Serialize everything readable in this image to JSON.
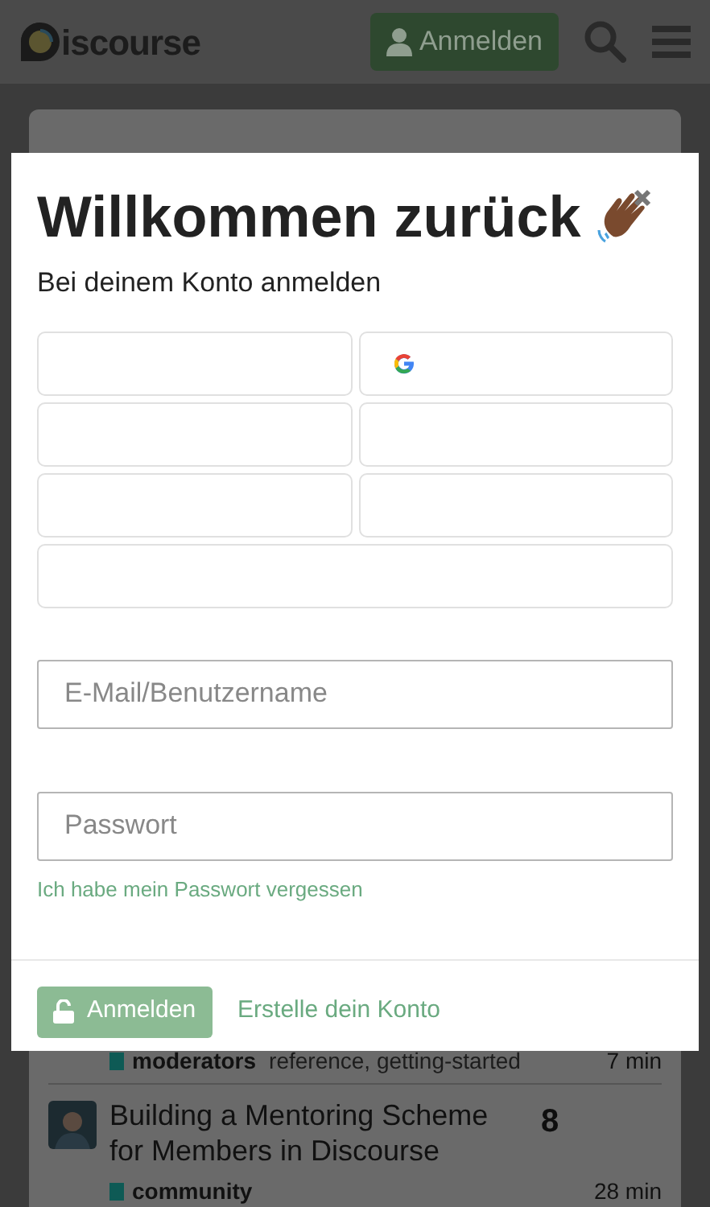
{
  "header": {
    "logo": "iscourse",
    "login_button": "Anmelden"
  },
  "topics": [
    {
      "category": "moderators",
      "tags": "reference, getting-started",
      "activity": "7 min"
    },
    {
      "title": "Building a Mentoring Scheme for Members in Discourse",
      "category": "community",
      "replies": "8",
      "activity": "28 min"
    }
  ],
  "modal": {
    "title": "Willkommen zurück",
    "subtitle": "Bei deinem Konto anmelden",
    "login_buttons": [
      {
        "kind": "blank"
      },
      {
        "kind": "google"
      },
      {
        "kind": "blank"
      },
      {
        "kind": "blank"
      },
      {
        "kind": "blank"
      },
      {
        "kind": "blank"
      },
      {
        "kind": "wide"
      }
    ],
    "email": {
      "placeholder": "E-Mail/Benutzername"
    },
    "password": {
      "placeholder": "Passwort"
    },
    "forgot_link": "Ich habe mein Passwort vergessen",
    "submit": "Anmelden",
    "signup_link": "Erstelle dein Konto"
  }
}
